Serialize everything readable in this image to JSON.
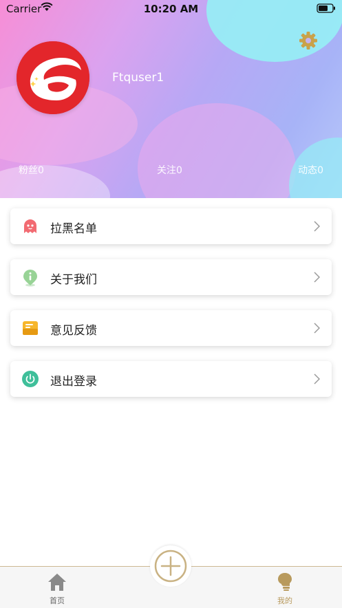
{
  "status_bar": {
    "carrier": "Carrier",
    "time": "10:20 AM"
  },
  "profile": {
    "username": "Ftquser1",
    "stats": {
      "fans": "粉丝0",
      "following": "关注0",
      "moments": "动态0"
    }
  },
  "menu": [
    {
      "label": "拉黑名单",
      "icon": "ghost-icon"
    },
    {
      "label": "关于我们",
      "icon": "info-pin-icon"
    },
    {
      "label": "意见反馈",
      "icon": "mailbox-icon"
    },
    {
      "label": "退出登录",
      "icon": "power-icon"
    }
  ],
  "tabbar": {
    "home_label": "首页",
    "mine_label": "我的",
    "active": "mine"
  },
  "colors": {
    "accent": "#b89a5d",
    "avatar_red": "#e3262b",
    "header_pink": "#f78ed6",
    "header_blue": "#a7b3f7"
  }
}
